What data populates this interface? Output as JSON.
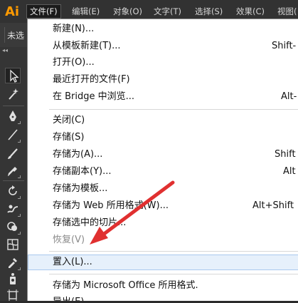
{
  "app": {
    "logo": "Ai",
    "document_tab_label": "未选"
  },
  "menubar": {
    "items": [
      {
        "label": "文件(F)",
        "active": true
      },
      {
        "label": "编辑(E)"
      },
      {
        "label": "对象(O)"
      },
      {
        "label": "文字(T)"
      },
      {
        "label": "选择(S)"
      },
      {
        "label": "效果(C)"
      },
      {
        "label": "视图("
      }
    ]
  },
  "file_menu": {
    "items": [
      {
        "label": "新建(N)...",
        "shortcut": ""
      },
      {
        "label": "从模板新建(T)...",
        "shortcut": "Shift-"
      },
      {
        "label": "打开(O)...",
        "shortcut": ""
      },
      {
        "label": "最近打开的文件(F)",
        "shortcut": ""
      },
      {
        "label": "在 Bridge 中浏览...",
        "shortcut": "Alt-"
      },
      {
        "label": "关闭(C)",
        "shortcut": ""
      },
      {
        "label": "存储(S)",
        "shortcut": ""
      },
      {
        "label": "存储为(A)...",
        "shortcut": "Shift"
      },
      {
        "label": "存储副本(Y)...",
        "shortcut": "Alt"
      },
      {
        "label": "存储为模板...",
        "shortcut": ""
      },
      {
        "label": "存储为 Web 所用格式(W)...",
        "shortcut": "Alt+Shift"
      },
      {
        "label": "存储选中的切片...",
        "shortcut": ""
      },
      {
        "label": "恢复(V)",
        "shortcut": "",
        "disabled": true
      },
      {
        "label": "置入(L)...",
        "shortcut": "",
        "highlighted": true
      },
      {
        "label": "存储为 Microsoft Office 所用格式.",
        "shortcut": ""
      },
      {
        "label": "导出(E)...",
        "shortcut": ""
      }
    ]
  },
  "toolbar": {
    "tools": [
      "selection-tool-icon",
      "magic-wand-icon",
      "pen-tool-icon",
      "line-tool-icon",
      "brush-tool-icon",
      "pencil-tool-icon",
      "rotate-tool-icon",
      "warp-tool-icon",
      "shape-builder-icon",
      "gradient-mesh-icon",
      "eyedropper-icon",
      "symbol-sprayer-icon",
      "artboard-tool-icon"
    ]
  },
  "annotation": {
    "arrow_color": "#e03030"
  },
  "colors": {
    "accent_logo": "#ff9a00",
    "menubar_bg": "#323232",
    "dropdown_bg": "#ffffff",
    "hover_bg": "#e6f0fb"
  }
}
